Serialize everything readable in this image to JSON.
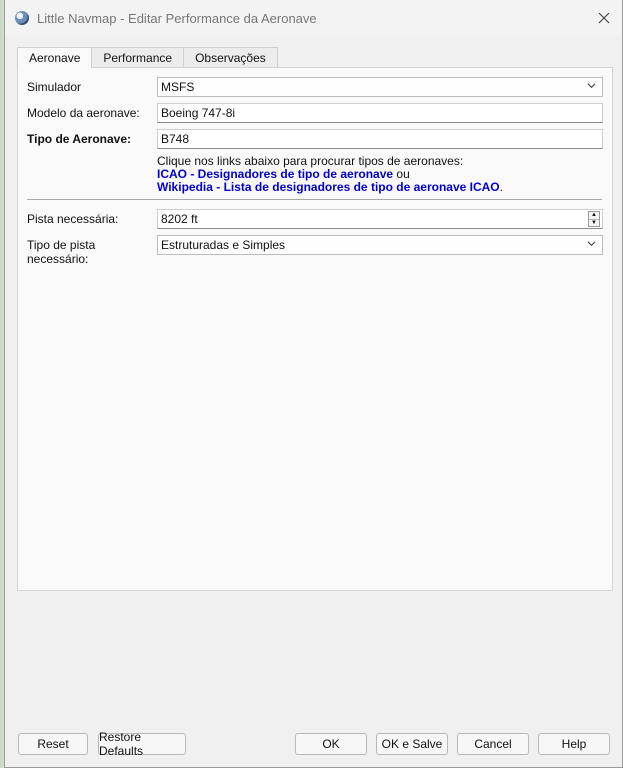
{
  "window": {
    "title": "Little Navmap - Editar Performance da Aeronave",
    "close_icon": "close-icon"
  },
  "tabs": [
    "Aeronave",
    "Performance",
    "Observações"
  ],
  "form": {
    "simulator_label": "Simulador",
    "simulator_value": "MSFS",
    "model_label": "Modelo da aeronave:",
    "model_value": "Boeing 747-8i",
    "type_label": "Tipo de Aeronave:",
    "type_value": "B748",
    "links_intro": "Clique nos links abaixo para procurar tipos de aeronaves:",
    "link_icao": "ICAO - Designadores de tipo de aeronave",
    "links_or": " ou",
    "link_wikipedia": "Wikipedia - Lista de designadores de tipo de aeronave ICAO",
    "links_end": ".",
    "runway_label": "Pista necessária:",
    "runway_value": "8202 ft",
    "runway_type_label": "Tipo de pista necessário:",
    "runway_type_value": "Estruturadas e Simples"
  },
  "buttons": {
    "reset": "Reset",
    "restore_defaults": "Restore Defaults",
    "ok": "OK",
    "ok_save": "OK e Salve",
    "cancel": "Cancel",
    "help": "Help"
  }
}
